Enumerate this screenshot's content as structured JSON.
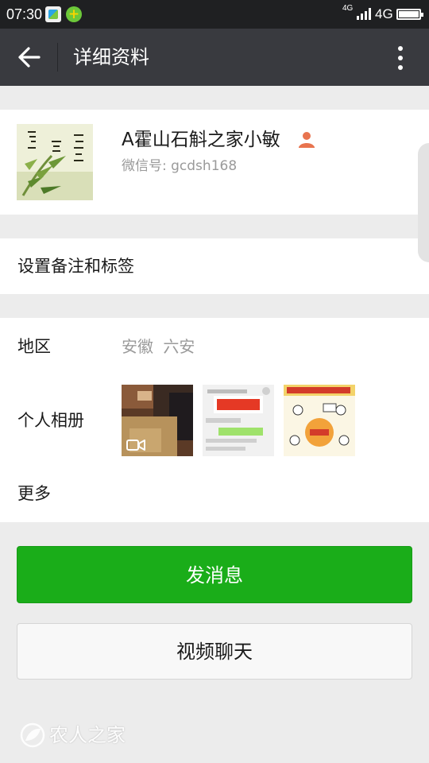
{
  "status_bar": {
    "time": "07:30",
    "network_small": "4G",
    "network": "4G"
  },
  "header": {
    "title": "详细资料",
    "back_icon": "arrow-left-icon",
    "more_icon": "more-vertical-icon"
  },
  "profile": {
    "name": "A霍山石斛之家小敏",
    "wechat_id": "微信号: gcdsh168",
    "contact_icon": "person-icon",
    "contact_icon_color": "#e8744f"
  },
  "remark_row": {
    "label": "设置备注和标签"
  },
  "info": {
    "region_label": "地区",
    "region_value": "安徽 六安",
    "album_label": "个人相册",
    "more_label": "更多"
  },
  "buttons": {
    "send_message": "发消息",
    "video_chat": "视频聊天"
  },
  "colors": {
    "primary_green": "#1aad19",
    "topbar": "#393a3f"
  },
  "watermark": {
    "text": "农人之家"
  }
}
